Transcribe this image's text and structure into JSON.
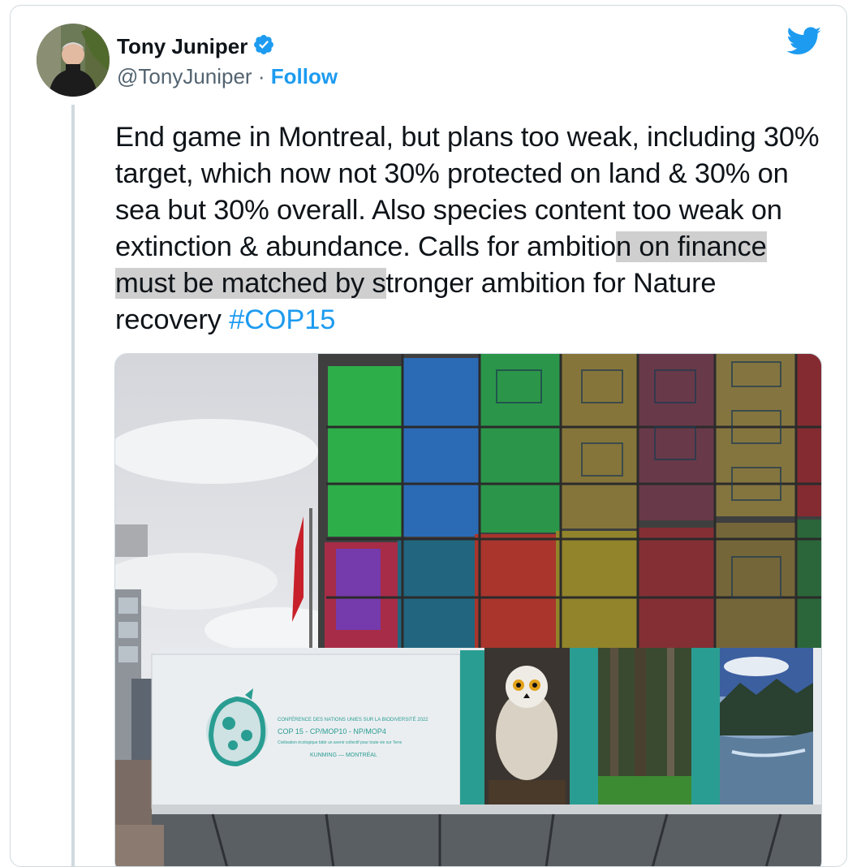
{
  "author": {
    "name": "Tony Juniper",
    "handle": "@TonyJuniper",
    "separator": "·",
    "follow_label": "Follow",
    "verified": true
  },
  "tweet": {
    "text_before_highlight": "End game in Montreal, but plans too weak, including 30% target, which now not 30% protected on land & 30% on sea but 30% overall. Also species content too weak on extinction & abundance. Calls for ambitio",
    "text_highlighted": "n on finance must be matched by s",
    "text_after_highlight": "tronger ambition for Nature recovery ",
    "hashtag": "#COP15"
  },
  "banner": {
    "line1": "CONFÉRENCE DES NATIONS UNIES SUR LA BIODIVERSITÉ 2022",
    "line2": "COP 15 - CP/MOP10 - NP/MOP4",
    "line3": "Civilisation écologique bâtir un avenir collectif pour toute vie sur Terre",
    "line4": "KUNMING — MONTRÉAL"
  },
  "colors": {
    "brand_blue": "#1d9bf0",
    "text": "#0f1419",
    "secondary_text": "#536471",
    "border": "#cfd9de",
    "highlight": "#cfcfcf",
    "teal": "#2a9d92"
  },
  "icons": {
    "verified": "verified-badge-icon",
    "twitter": "twitter-bird-icon"
  }
}
